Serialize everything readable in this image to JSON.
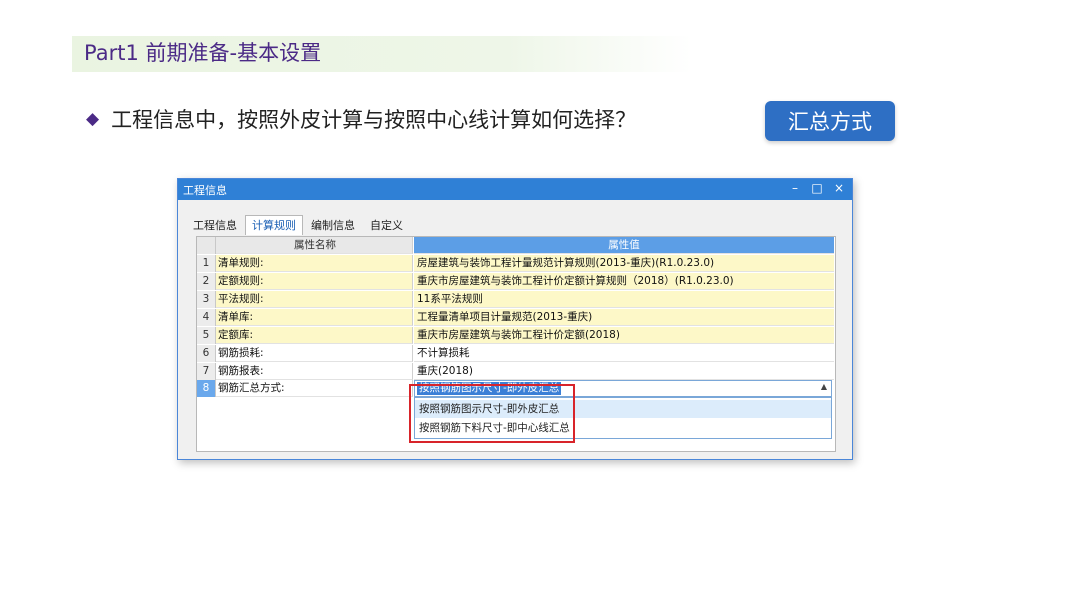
{
  "slide": {
    "title": "Part1 前期准备-基本设置",
    "question": "工程信息中，按照外皮计算与按照中心线计算如何选择？",
    "bullet": "◆",
    "badge": "汇总方式",
    "accent_color": "#4b2a86",
    "badge_color": "#2e6fc4"
  },
  "window": {
    "title": "工程信息",
    "controls": {
      "minimize": "–",
      "maximize": "□",
      "close": "×"
    },
    "tabs": [
      {
        "label": "工程信息",
        "active": false
      },
      {
        "label": "计算规则",
        "active": true
      },
      {
        "label": "编制信息",
        "active": false
      },
      {
        "label": "自定义",
        "active": false
      }
    ],
    "grid": {
      "headers": {
        "name": "属性名称",
        "value": "属性值"
      },
      "rows": [
        {
          "num": "1",
          "name": "清单规则:",
          "value": "房屋建筑与装饰工程计量规范计算规则(2013-重庆)(R1.0.23.0)"
        },
        {
          "num": "2",
          "name": "定额规则:",
          "value": "重庆市房屋建筑与装饰工程计价定额计算规则（2018）(R1.0.23.0)"
        },
        {
          "num": "3",
          "name": "平法规则:",
          "value": "11系平法规则"
        },
        {
          "num": "4",
          "name": "清单库:",
          "value": "工程量清单项目计量规范(2013-重庆)"
        },
        {
          "num": "5",
          "name": "定额库:",
          "value": "重庆市房屋建筑与装饰工程计价定额(2018)"
        },
        {
          "num": "6",
          "name": "钢筋损耗:",
          "value": "不计算损耗"
        },
        {
          "num": "7",
          "name": "钢筋报表:",
          "value": "重庆(2018)"
        },
        {
          "num": "8",
          "name": "钢筋汇总方式:",
          "value": "按照钢筋图示尺寸-即外皮汇总"
        }
      ],
      "dropdown_options": [
        "按照钢筋图示尺寸-即外皮汇总",
        "按照钢筋下料尺寸-即中心线汇总"
      ]
    }
  }
}
